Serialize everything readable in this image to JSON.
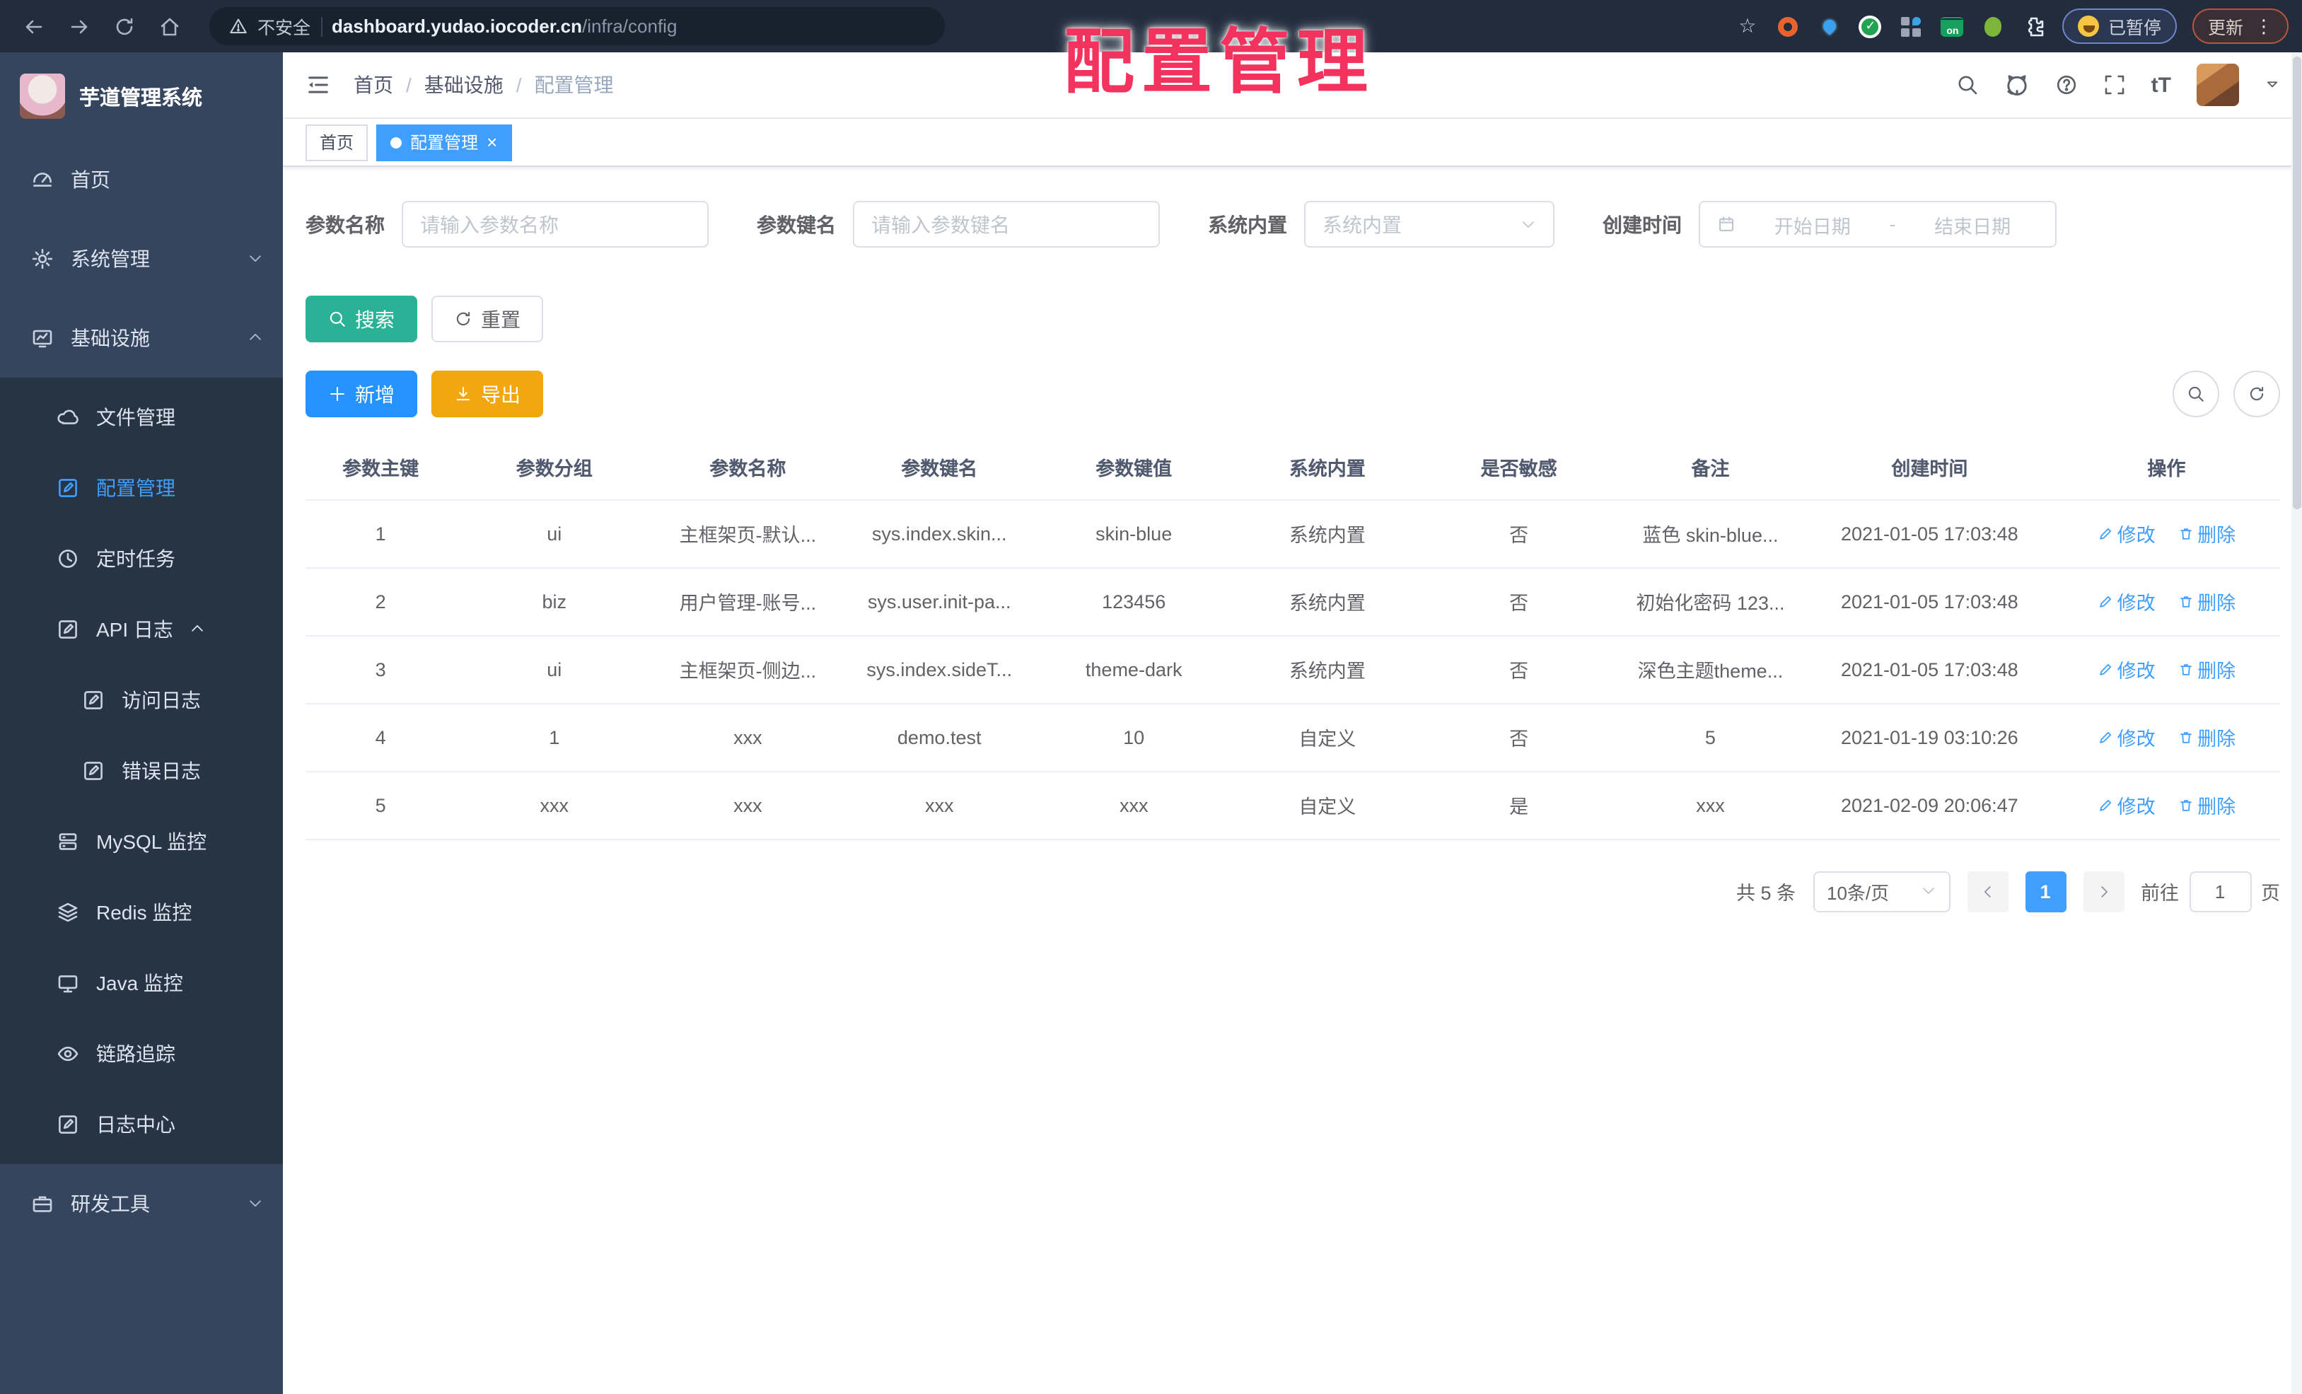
{
  "browser": {
    "security_label": "不安全",
    "url_host": "dashboard.yudao.iocoder.cn",
    "url_path": "/infra/config",
    "paused_badge": "已暂停",
    "update_label": "更新",
    "kebab": "⋮",
    "bookmark_star": "☆",
    "on_badge": "on",
    "check_glyph": "✓"
  },
  "overlay_title": "配置管理",
  "sidebar": {
    "logo_title": "芋道管理系统",
    "items": [
      {
        "label": "首页"
      },
      {
        "label": "系统管理"
      },
      {
        "label": "基础设施"
      },
      {
        "label": "文件管理"
      },
      {
        "label": "配置管理"
      },
      {
        "label": "定时任务"
      },
      {
        "label": "API 日志"
      },
      {
        "label": "访问日志"
      },
      {
        "label": "错误日志"
      },
      {
        "label": "MySQL 监控"
      },
      {
        "label": "Redis 监控"
      },
      {
        "label": "Java 监控"
      },
      {
        "label": "链路追踪"
      },
      {
        "label": "日志中心"
      },
      {
        "label": "研发工具"
      }
    ]
  },
  "header": {
    "breadcrumb": [
      "首页",
      "基础设施",
      "配置管理"
    ],
    "breadcrumb_separator": "/",
    "font_size_icon": "tT"
  },
  "tabs": [
    {
      "label": "首页"
    },
    {
      "label": "配置管理",
      "close": "×"
    }
  ],
  "filters": {
    "name_label": "参数名称",
    "name_placeholder": "请输入参数名称",
    "key_label": "参数键名",
    "key_placeholder": "请输入参数键名",
    "builtin_label": "系统内置",
    "builtin_placeholder": "系统内置",
    "time_label": "创建时间",
    "start_placeholder": "开始日期",
    "range_separator": "-",
    "end_placeholder": "结束日期"
  },
  "actions": {
    "search": "搜索",
    "reset": "重置",
    "add": "新增",
    "export": "导出"
  },
  "table": {
    "headers": [
      "参数主键",
      "参数分组",
      "参数名称",
      "参数键名",
      "参数键值",
      "系统内置",
      "是否敏感",
      "备注",
      "创建时间",
      "操作"
    ],
    "edit_label": "修改",
    "delete_label": "删除",
    "rows": [
      [
        "1",
        "ui",
        "主框架页-默认...",
        "sys.index.skin...",
        "skin-blue",
        "系统内置",
        "否",
        "蓝色 skin-blue...",
        "2021-01-05 17:03:48"
      ],
      [
        "2",
        "biz",
        "用户管理-账号...",
        "sys.user.init-pa...",
        "123456",
        "系统内置",
        "否",
        "初始化密码 123...",
        "2021-01-05 17:03:48"
      ],
      [
        "3",
        "ui",
        "主框架页-侧边...",
        "sys.index.sideT...",
        "theme-dark",
        "系统内置",
        "否",
        "深色主题theme...",
        "2021-01-05 17:03:48"
      ],
      [
        "4",
        "1",
        "xxx",
        "demo.test",
        "10",
        "自定义",
        "否",
        "5",
        "2021-01-19 03:10:26"
      ],
      [
        "5",
        "xxx",
        "xxx",
        "xxx",
        "xxx",
        "自定义",
        "是",
        "xxx",
        "2021-02-09 20:06:47"
      ]
    ]
  },
  "pagination": {
    "total": "共 5 条",
    "page_size": "10条/页",
    "current": "1",
    "goto_label": "前往",
    "goto_value": "1",
    "page_unit": "页"
  },
  "colors": {
    "accent": "#409eff",
    "search_teal": "#2bb195",
    "export_orange": "#f2a711",
    "overlay_red": "#f2335d",
    "sidebar_bg": "#36455e",
    "submenu_bg": "#273444"
  }
}
